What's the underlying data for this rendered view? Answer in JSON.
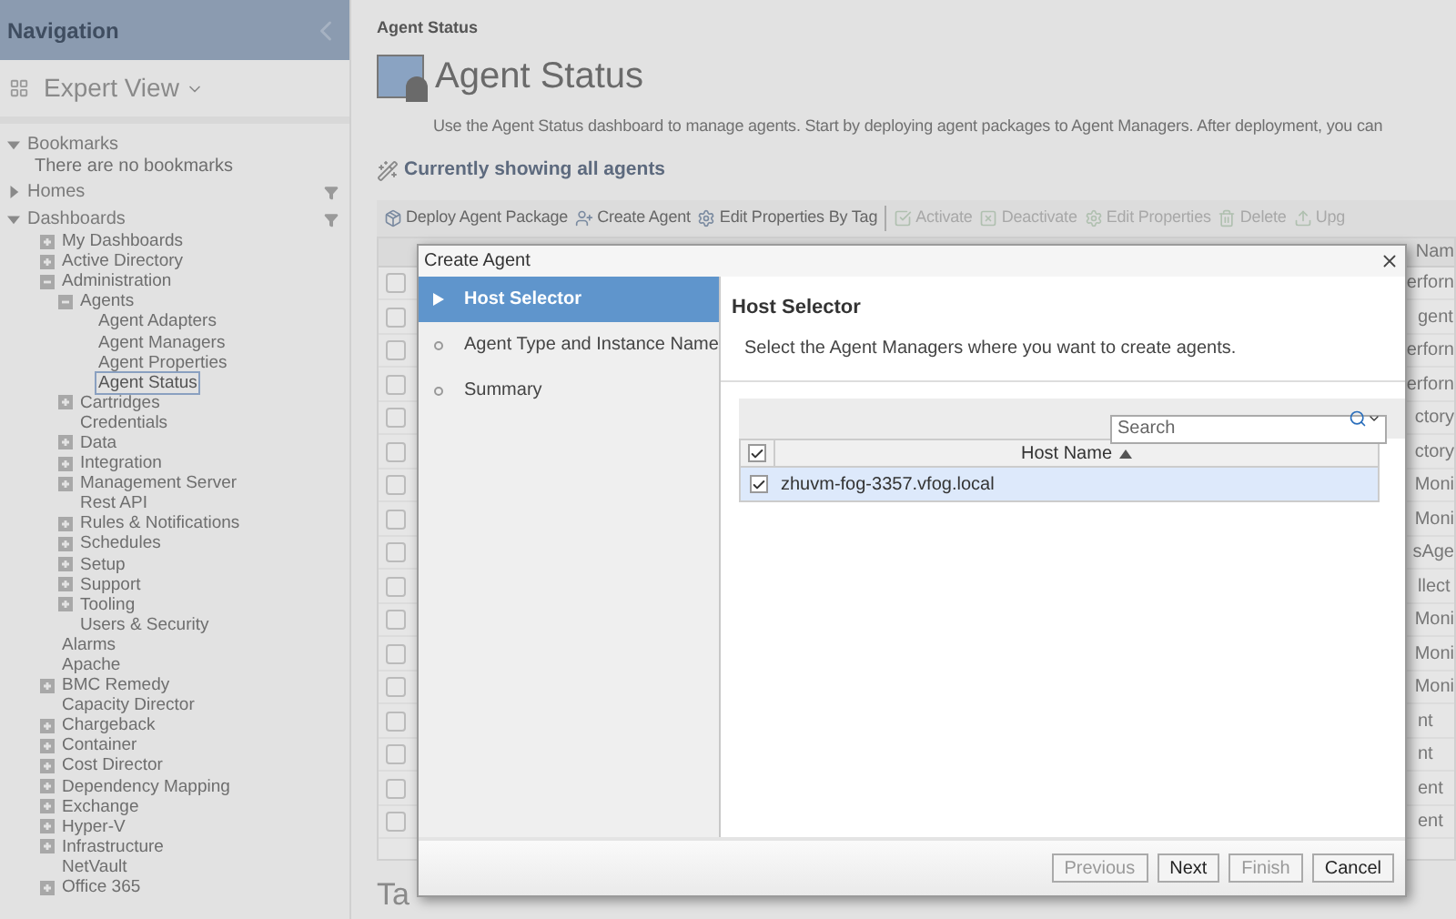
{
  "sidebar": {
    "title": "Navigation",
    "view": "Expert View",
    "sections": [
      {
        "label": "Bookmarks",
        "expanded": true,
        "filter": false,
        "note": "There are no bookmarks"
      },
      {
        "label": "Homes",
        "expanded": false,
        "filter": true
      },
      {
        "label": "Dashboards",
        "expanded": true,
        "filter": true,
        "items": [
          {
            "label": "My Dashboards",
            "kind": "group",
            "expanded": false,
            "selected": false
          },
          {
            "label": "Active Directory",
            "kind": "group",
            "expanded": false,
            "selected": false
          },
          {
            "label": "Administration",
            "kind": "group",
            "expanded": true,
            "selected": false,
            "children": [
              {
                "label": "Agents",
                "kind": "group",
                "expanded": true,
                "selected": false,
                "children": [
                  {
                    "label": "Agent Adapters",
                    "kind": "leaf",
                    "selected": false
                  },
                  {
                    "label": "Agent Managers",
                    "kind": "leaf",
                    "selected": false
                  },
                  {
                    "label": "Agent Properties",
                    "kind": "leaf",
                    "selected": false
                  },
                  {
                    "label": "Agent Status",
                    "kind": "leaf",
                    "selected": true
                  }
                ]
              },
              {
                "label": "Cartridges",
                "kind": "group",
                "expanded": false,
                "selected": false
              },
              {
                "label": "Credentials",
                "kind": "leaf",
                "selected": false
              },
              {
                "label": "Data",
                "kind": "group",
                "expanded": false,
                "selected": false
              },
              {
                "label": "Integration",
                "kind": "group",
                "expanded": false,
                "selected": false
              },
              {
                "label": "Management Server",
                "kind": "group",
                "expanded": false,
                "selected": false
              },
              {
                "label": "Rest API",
                "kind": "leaf",
                "selected": false
              },
              {
                "label": "Rules & Notifications",
                "kind": "group",
                "expanded": false,
                "selected": false
              },
              {
                "label": "Schedules",
                "kind": "group",
                "expanded": false,
                "selected": false
              },
              {
                "label": "Setup",
                "kind": "group",
                "expanded": false,
                "selected": false
              },
              {
                "label": "Support",
                "kind": "group",
                "expanded": false,
                "selected": false
              },
              {
                "label": "Tooling",
                "kind": "group",
                "expanded": false,
                "selected": false
              },
              {
                "label": "Users & Security",
                "kind": "leaf",
                "selected": false
              }
            ]
          },
          {
            "label": "Alarms",
            "kind": "leaf",
            "selected": false
          },
          {
            "label": "Apache",
            "kind": "leaf",
            "selected": false
          },
          {
            "label": "BMC Remedy",
            "kind": "group",
            "expanded": false,
            "selected": false
          },
          {
            "label": "Capacity Director",
            "kind": "leaf",
            "selected": false
          },
          {
            "label": "Chargeback",
            "kind": "group",
            "expanded": false,
            "selected": false
          },
          {
            "label": "Container",
            "kind": "group",
            "expanded": false,
            "selected": false
          },
          {
            "label": "Cost Director",
            "kind": "group",
            "expanded": false,
            "selected": false
          },
          {
            "label": "Dependency Mapping",
            "kind": "group",
            "expanded": false,
            "selected": false
          },
          {
            "label": "Exchange",
            "kind": "group",
            "expanded": false,
            "selected": false
          },
          {
            "label": "Hyper-V",
            "kind": "group",
            "expanded": false,
            "selected": false
          },
          {
            "label": "Infrastructure",
            "kind": "group",
            "expanded": false,
            "selected": false
          },
          {
            "label": "NetVault",
            "kind": "leaf",
            "selected": false
          },
          {
            "label": "Office 365",
            "kind": "group",
            "expanded": false,
            "selected": false
          }
        ]
      }
    ]
  },
  "page": {
    "breadcrumb": "Agent Status",
    "title": "Agent Status",
    "description": "Use the Agent Status dashboard to manage agents. Start by deploying agent packages to Agent Managers. After deployment, you can",
    "filter_label": "Currently showing all agents",
    "toolbar": [
      {
        "label": "Deploy Agent Package",
        "kind": "deploy",
        "disabled": false
      },
      {
        "label": "Create Agent",
        "kind": "create",
        "disabled": false
      },
      {
        "label": "Edit Properties By Tag",
        "kind": "edit",
        "disabled": false
      },
      {
        "label": "Activate",
        "kind": "activate",
        "disabled": true
      },
      {
        "label": "Deactivate",
        "kind": "deactivate",
        "disabled": true
      },
      {
        "label": "Edit Properties",
        "kind": "edit",
        "disabled": true
      },
      {
        "label": "Delete",
        "kind": "delete",
        "disabled": true
      },
      {
        "label": "Upg",
        "kind": "upgrade",
        "disabled": true
      }
    ],
    "table": {
      "column_4": "Nam",
      "rows": [
        {
          "column_4": "erforn",
          "checked": false
        },
        {
          "column_4": "gent",
          "checked": false
        },
        {
          "column_4": "erforn",
          "checked": false
        },
        {
          "column_4": "erforn",
          "checked": false
        },
        {
          "column_4": "ctory",
          "checked": false
        },
        {
          "column_4": "ctory",
          "checked": false
        },
        {
          "column_4": "Moni",
          "checked": false
        },
        {
          "column_4": "Moni",
          "checked": false
        },
        {
          "column_4": "sAge",
          "checked": false
        },
        {
          "column_4": "llect",
          "checked": false
        },
        {
          "column_4": "Moni",
          "checked": false
        },
        {
          "column_4": "Moni",
          "checked": false
        },
        {
          "column_4": "Moni",
          "checked": false
        },
        {
          "column_4": "nt",
          "checked": false
        },
        {
          "column_4": "nt",
          "checked": false
        },
        {
          "column_4": "ent",
          "checked": false
        },
        {
          "column_4": "ent",
          "checked": false
        }
      ]
    },
    "bottom_heading": "Ta"
  },
  "dialog": {
    "title": "Create Agent",
    "steps": [
      {
        "label": "Host Selector",
        "selected": true
      },
      {
        "label": "Agent Type and Instance Name",
        "selected": false
      },
      {
        "label": "Summary",
        "selected": false
      }
    ],
    "heading": "Host Selector",
    "instruction": "Select the Agent Managers where you want to create agents.",
    "search": {
      "placeholder": "Search"
    },
    "grid": {
      "all_checked": true,
      "column": "Host Name",
      "sort_ascending": true,
      "rows": [
        {
          "host": "zhuvm-fog-3357.vfog.local",
          "checked": true,
          "selected": true
        }
      ]
    },
    "buttons": [
      {
        "label": "Previous",
        "disabled": true
      },
      {
        "label": "Next",
        "disabled": false
      },
      {
        "label": "Finish",
        "disabled": true
      },
      {
        "label": "Cancel",
        "disabled": false
      }
    ]
  }
}
